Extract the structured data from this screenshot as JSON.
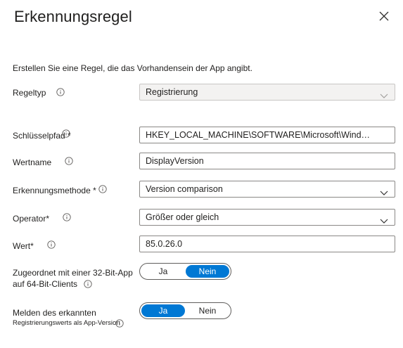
{
  "panel": {
    "title": "Erkennungsregel",
    "description": "Erstellen Sie eine Regel, die das Vorhandensein der App angibt."
  },
  "fields": {
    "regeltyp": {
      "label": "Regeltyp",
      "value": "Registrierung"
    },
    "schluesselpfad": {
      "label": "Schlüsselpfad *",
      "value": "HKEY_LOCAL_MACHINE\\SOFTWARE\\Microsoft\\Windows\\C..."
    },
    "wertname": {
      "label": "Wertname",
      "value": "DisplayVersion"
    },
    "erkennungsmethode": {
      "label": "Erkennungsmethode *",
      "value": "Version comparison"
    },
    "operator": {
      "label": "Operator*",
      "value": "Größer oder gleich"
    },
    "wert": {
      "label": "Wert*",
      "value": "85.0.26.0"
    }
  },
  "toggles": {
    "bit32": {
      "label_line1": "Zugeordnet mit einer 32-Bit-App",
      "label_line2": "auf 64-Bit-Clients",
      "option_left": "Ja",
      "option_right": "Nein",
      "selected": "Nein"
    },
    "report": {
      "label_line1": "Melden des erkannten",
      "label_line2": "Registrierungswerts als App-Version",
      "option_left": "Ja",
      "option_right": "Nein",
      "selected": "Ja"
    }
  },
  "colors": {
    "accent": "#0078d4",
    "border": "#8a8886",
    "disabled_bg": "#f3f2f1"
  },
  "icons": [
    "close-icon",
    "info-icon",
    "chevron-down-icon"
  ]
}
